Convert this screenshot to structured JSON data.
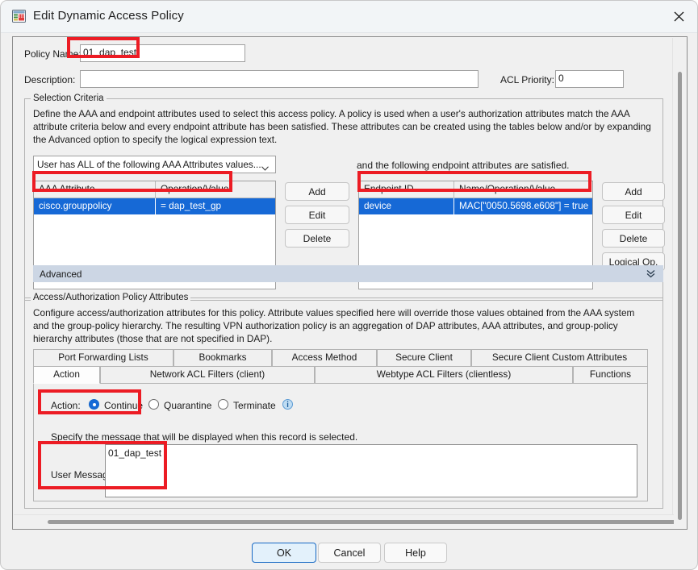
{
  "window": {
    "title": "Edit Dynamic Access Policy",
    "app_icon": "application-window-icon",
    "close_label": "✕"
  },
  "form": {
    "policy_name_label": "Policy Name:",
    "policy_name_value": "01_dap_test",
    "description_label": "Description:",
    "description_value": "",
    "acl_priority_label": "ACL Priority:",
    "acl_priority_value": "0"
  },
  "selection_criteria": {
    "group_title": "Selection Criteria",
    "paragraph": "Define the AAA and endpoint attributes used to select this access policy. A policy is used when a user's authorization attributes match the AAA attribute criteria below and every endpoint attribute has been satisfied. These attributes can be created using the tables below and/or by expanding the Advanced option to specify the logical expression text.",
    "aaa_combo_value": "User has ALL of the following AAA Attributes values...",
    "endpoint_note": "and the following endpoint attributes are satisfied.",
    "aaa_table": {
      "columns": [
        "AAA Attribute",
        "Operation/Value"
      ],
      "rows": [
        {
          "attribute": "cisco.grouppolicy",
          "operation_value": "=   dap_test_gp",
          "selected": true
        }
      ]
    },
    "aaa_buttons": [
      "Add",
      "Edit",
      "Delete"
    ],
    "endpoint_table": {
      "columns": [
        "Endpoint ID",
        "Name/Operation/Value"
      ],
      "rows": [
        {
          "endpoint_id": "device",
          "name_operation_value": "MAC[\"0050.5698.e608\"]  =  true",
          "selected": true
        }
      ]
    },
    "endpoint_buttons": [
      "Add",
      "Edit",
      "Delete",
      "Logical Op."
    ]
  },
  "advanced": {
    "label": "Advanced",
    "chevron": "chevron-double-down-icon"
  },
  "access_policy": {
    "group_title": "Access/Authorization Policy Attributes",
    "paragraph": "Configure access/authorization attributes for this policy. Attribute values specified here will override those values obtained from the AAA system and the group-policy hierarchy. The resulting VPN authorization policy is an aggregation of DAP attributes, AAA attributes, and group-policy hierarchy attributes (those that are not specified in DAP).",
    "tabs_row_top": [
      {
        "label": "Port Forwarding Lists",
        "active": false
      },
      {
        "label": "Bookmarks",
        "active": false
      },
      {
        "label": "Access Method",
        "active": false
      },
      {
        "label": "Secure Client",
        "active": false
      },
      {
        "label": "Secure Client Custom Attributes",
        "active": false
      }
    ],
    "tabs_row_bottom": [
      {
        "label": "Action",
        "active": true
      },
      {
        "label": "Network ACL Filters (client)",
        "active": false
      },
      {
        "label": "Webtype ACL Filters (clientless)",
        "active": false
      },
      {
        "label": "Functions",
        "active": false
      }
    ],
    "action": {
      "label": "Action:",
      "options": [
        {
          "label": "Continue",
          "selected": true
        },
        {
          "label": "Quarantine",
          "selected": false
        },
        {
          "label": "Terminate",
          "selected": false
        }
      ],
      "info_icon": "info-icon"
    },
    "user_message": {
      "hint": "Specify the message that will be displayed when this record is selected.",
      "label": "User Message:",
      "value": "01_dap_test"
    }
  },
  "footer": {
    "ok_label": "OK",
    "cancel_label": "Cancel",
    "help_label": "Help"
  },
  "colors": {
    "selection_blue": "#1669d6",
    "annotation_red": "#ec1c24",
    "advanced_bar": "#ccd6e4",
    "default_button": "#e3f1fb"
  }
}
